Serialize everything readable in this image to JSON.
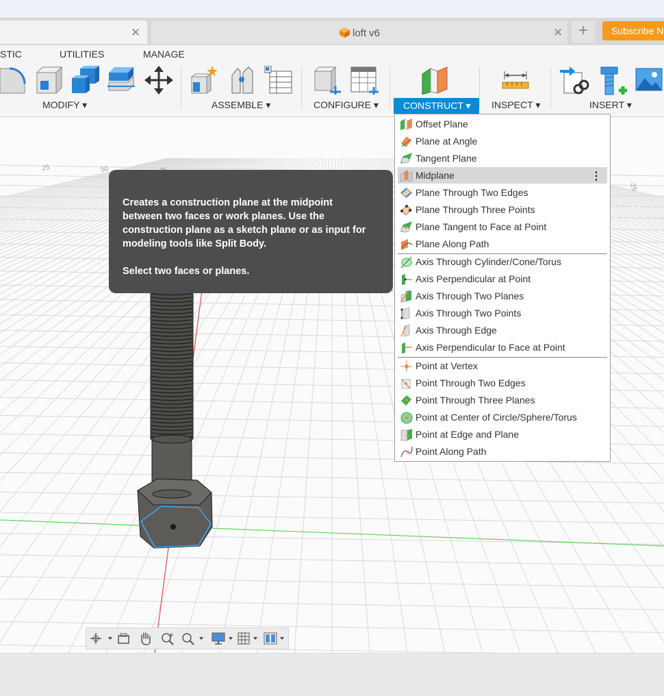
{
  "tabs": {
    "document_title": "loft v6",
    "close_glyph": "✕",
    "new_tab_glyph": "+",
    "subscribe_label": "Subscribe Now"
  },
  "menu_tabs": [
    "STIC",
    "UTILITIES",
    "MANAGE"
  ],
  "toolbar_groups": [
    "MODIFY ▾",
    "ASSEMBLE ▾",
    "CONFIGURE ▾",
    "CONSTRUCT ▾",
    "INSPECT ▾",
    "INSERT ▾"
  ],
  "tooltip": {
    "lines": [
      "Creates a construction plane at the midpoint",
      "between two faces or work planes. Use the",
      "construction plane as a sketch plane or as input for",
      "modeling tools like Split Body."
    ],
    "hint": "Select two faces or planes."
  },
  "construct_menu": {
    "highlighted_item": "Midplane",
    "more_glyph": "⋮",
    "items": [
      {
        "label": "Offset Plane",
        "icon": "offset-plane-icon"
      },
      {
        "label": "Plane at Angle",
        "icon": "plane-at-angle-icon"
      },
      {
        "label": "Tangent Plane",
        "icon": "tangent-plane-icon"
      },
      {
        "label": "Midplane",
        "icon": "midplane-icon"
      },
      {
        "label": "Plane Through Two Edges",
        "icon": "plane-two-edges-icon"
      },
      {
        "label": "Plane Through Three Points",
        "icon": "plane-three-points-icon"
      },
      {
        "label": "Plane Tangent to Face at Point",
        "icon": "plane-tangent-face-icon"
      },
      {
        "label": "Plane Along Path",
        "icon": "plane-along-path-icon"
      },
      {
        "label": "Axis Through Cylinder/Cone/Torus",
        "icon": "axis-cylinder-icon"
      },
      {
        "label": "Axis Perpendicular at Point",
        "icon": "axis-perpendicular-point-icon"
      },
      {
        "label": "Axis Through Two Planes",
        "icon": "axis-two-planes-icon"
      },
      {
        "label": "Axis Through Two Points",
        "icon": "axis-two-points-icon"
      },
      {
        "label": "Axis Through Edge",
        "icon": "axis-edge-icon"
      },
      {
        "label": "Axis Perpendicular to Face at Point",
        "icon": "axis-perpendicular-face-icon"
      },
      {
        "label": "Point at Vertex",
        "icon": "point-vertex-icon"
      },
      {
        "label": "Point Through Two Edges",
        "icon": "point-two-edges-icon"
      },
      {
        "label": "Point Through Three Planes",
        "icon": "point-three-planes-icon"
      },
      {
        "label": "Point at Center of Circle/Sphere/Torus",
        "icon": "point-center-icon"
      },
      {
        "label": "Point at Edge and Plane",
        "icon": "point-edge-plane-icon"
      },
      {
        "label": "Point Along Path",
        "icon": "point-along-path-icon"
      }
    ]
  },
  "viewport": {
    "ruler_labels": [
      "25",
      "50",
      "75",
      "-25"
    ]
  },
  "colors": {
    "accent": "#0b8ad8",
    "subscribe": "#f79a1c",
    "tooltip_bg": "#4d4d4d",
    "grid_line": "#d9d9d9",
    "x_axis": "#e34b4b",
    "y_axis": "#5fd35f",
    "selection": "#3aa7f0"
  }
}
